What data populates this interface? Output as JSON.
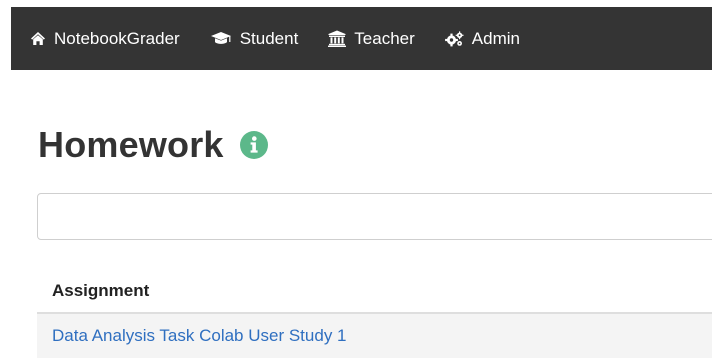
{
  "navbar": {
    "items": [
      {
        "label": "NotebookGrader",
        "icon": "home-icon"
      },
      {
        "label": "Student",
        "icon": "graduation-cap-icon"
      },
      {
        "label": "Teacher",
        "icon": "university-icon"
      },
      {
        "label": "Admin",
        "icon": "gears-icon"
      }
    ],
    "background": "#343434"
  },
  "page": {
    "title": "Homework",
    "info_icon": "info-circle-icon",
    "info_color": "#5cb88a"
  },
  "search": {
    "value": "",
    "placeholder": ""
  },
  "table": {
    "header": "Assignment",
    "rows": [
      {
        "assignment": "Data Analysis Task Colab User Study 1"
      }
    ],
    "link_color": "#2f6fc0"
  }
}
